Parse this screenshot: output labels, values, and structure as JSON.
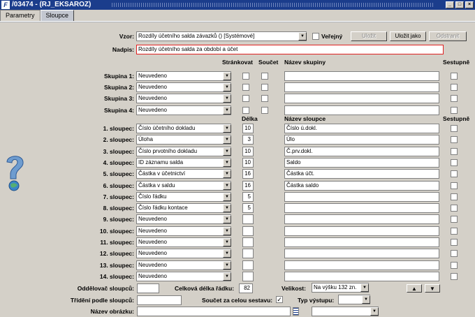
{
  "title": "/03474 - (RJ_EKSAROZ)",
  "tabs": [
    "Parametry",
    "Sloupce"
  ],
  "vzor": {
    "label": "Vzor:",
    "value": "Rozdíly účetního salda závazků   ()   [Systémové]",
    "public_label": "Veřejný",
    "public_checked": false,
    "save": "Uložit",
    "save_as": "Uložit jako",
    "remove": "Odstranit"
  },
  "nadpis": {
    "label": "Nadpis:",
    "value": "Rozdíly účetního salda za období a účet"
  },
  "group_headers": {
    "paging": "Stránkovat",
    "sum": "Součet",
    "name": "Název skupiny",
    "desc": "Sestupně"
  },
  "groups": [
    {
      "label": "Skupina 1:",
      "value": "Neuvedeno"
    },
    {
      "label": "Skupina 2:",
      "value": "Neuvedeno"
    },
    {
      "label": "Skupina 3:",
      "value": "Neuvedeno"
    },
    {
      "label": "Skupina 4:",
      "value": "Neuvedeno"
    }
  ],
  "col_headers": {
    "length": "Délka",
    "name": "Název sloupce",
    "desc": "Sestupně"
  },
  "columns": [
    {
      "label": "1. sloupec:",
      "value": "Číslo účetního dokladu",
      "length": "10",
      "name": "Číslo ú.dokl."
    },
    {
      "label": "2. sloupec:",
      "value": "Úloha",
      "length": "3",
      "name": "Úlo"
    },
    {
      "label": "3. sloupec:",
      "value": "Číslo prvotního dokladu",
      "length": "10",
      "name": "Č.prv.dokl."
    },
    {
      "label": "4. sloupec:",
      "value": "ID záznamu salda",
      "length": "10",
      "name": "Saldo"
    },
    {
      "label": "5. sloupec:",
      "value": "Částka v účetnictví",
      "length": "16",
      "name": "Částka účt."
    },
    {
      "label": "6. sloupec:",
      "value": "Částka v saldu",
      "length": "16",
      "name": "Částka saldo"
    },
    {
      "label": "7. sloupec:",
      "value": "Číslo řádku",
      "length": "5",
      "name": ""
    },
    {
      "label": "8. sloupec:",
      "value": "Číslo řádku kontace",
      "length": "5",
      "name": ""
    },
    {
      "label": "9. sloupec:",
      "value": "Neuvedeno",
      "length": "",
      "name": ""
    },
    {
      "label": "10. sloupec:",
      "value": "Neuvedeno",
      "length": "",
      "name": ""
    },
    {
      "label": "11. sloupec:",
      "value": "Neuvedeno",
      "length": "",
      "name": ""
    },
    {
      "label": "12. sloupec:",
      "value": "Neuvedeno",
      "length": "",
      "name": ""
    },
    {
      "label": "13. sloupec:",
      "value": "Neuvedeno",
      "length": "",
      "name": ""
    },
    {
      "label": "14. sloupec:",
      "value": "Neuvedeno",
      "length": "",
      "name": ""
    }
  ],
  "bottom": {
    "separator_label": "Oddělovač sloupců:",
    "separator_value": "",
    "total_length_label": "Celková délka řádku:",
    "total_length_value": "82",
    "size_label": "Velikost:",
    "size_value": "Na výšku 132 zn.",
    "sort_label": "Třídění podle sloupců:",
    "sort_value": "",
    "sum_all_label": "Součet za celou sestavu:",
    "sum_all_checked": true,
    "output_label": "Typ výstupu:",
    "output_value": "",
    "image_label": "Název obrázku:",
    "image_value": "",
    "image_combo": ""
  }
}
